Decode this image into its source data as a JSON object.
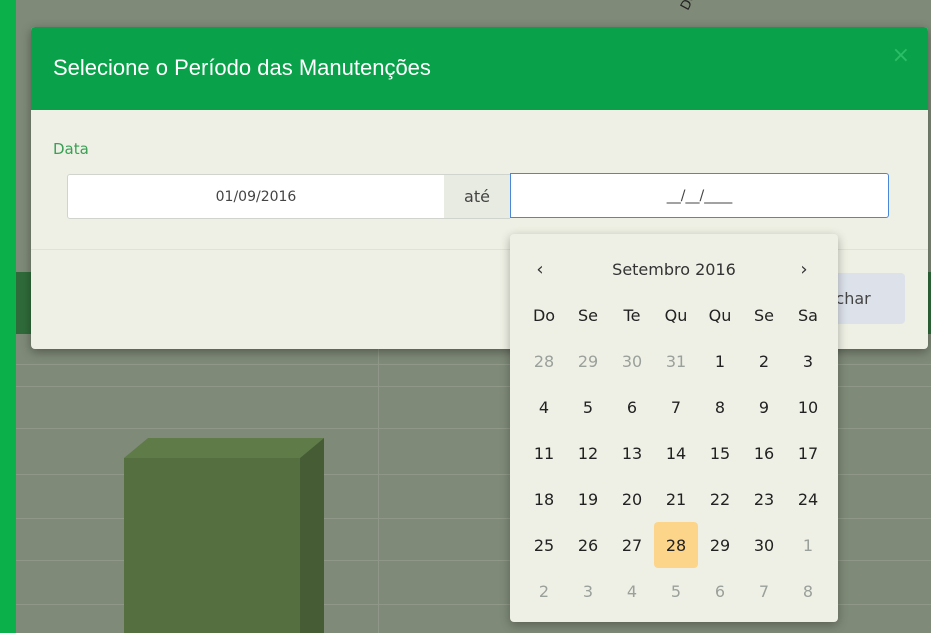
{
  "background": {
    "rotated_label": "DC"
  },
  "modal": {
    "title": "Selecione o Período das Manutenções",
    "close_symbol": "×",
    "field_label": "Data",
    "start_value": "01/09/2016",
    "separator": "até",
    "end_value": "__/__/____",
    "close_button": "Fechar"
  },
  "datepicker": {
    "prev": "‹",
    "next": "›",
    "title": "Setembro 2016",
    "weekdays": [
      "Do",
      "Se",
      "Te",
      "Qu",
      "Qu",
      "Se",
      "Sa"
    ],
    "weeks": [
      [
        {
          "d": "28",
          "other": true
        },
        {
          "d": "29",
          "other": true
        },
        {
          "d": "30",
          "other": true
        },
        {
          "d": "31",
          "other": true
        },
        {
          "d": "1"
        },
        {
          "d": "2"
        },
        {
          "d": "3"
        }
      ],
      [
        {
          "d": "4"
        },
        {
          "d": "5"
        },
        {
          "d": "6"
        },
        {
          "d": "7"
        },
        {
          "d": "8"
        },
        {
          "d": "9"
        },
        {
          "d": "10"
        }
      ],
      [
        {
          "d": "11"
        },
        {
          "d": "12"
        },
        {
          "d": "13"
        },
        {
          "d": "14"
        },
        {
          "d": "15"
        },
        {
          "d": "16"
        },
        {
          "d": "17"
        }
      ],
      [
        {
          "d": "18"
        },
        {
          "d": "19"
        },
        {
          "d": "20"
        },
        {
          "d": "21"
        },
        {
          "d": "22"
        },
        {
          "d": "23"
        },
        {
          "d": "24"
        }
      ],
      [
        {
          "d": "25"
        },
        {
          "d": "26"
        },
        {
          "d": "27"
        },
        {
          "d": "28",
          "today": true
        },
        {
          "d": "29"
        },
        {
          "d": "30"
        },
        {
          "d": "1",
          "other": true
        }
      ],
      [
        {
          "d": "2",
          "other": true
        },
        {
          "d": "3",
          "other": true
        },
        {
          "d": "4",
          "other": true
        },
        {
          "d": "5",
          "other": true
        },
        {
          "d": "6",
          "other": true
        },
        {
          "d": "7",
          "other": true
        },
        {
          "d": "8",
          "other": true
        }
      ]
    ]
  },
  "colors": {
    "accent_green": "#09a24a",
    "today_highlight": "#fdd58a",
    "focus_border": "#4a87d6"
  }
}
